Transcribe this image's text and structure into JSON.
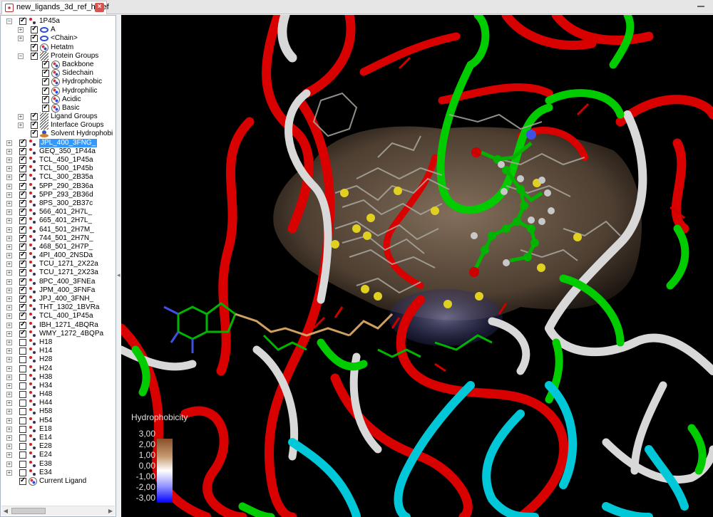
{
  "tab": {
    "title": "new_ligands_3d_ref_h_ref",
    "close": "×"
  },
  "tree": [
    {
      "label": "1P45a",
      "indent": 0,
      "expander": "minus",
      "checked": true,
      "icon": "molecule-icon"
    },
    {
      "label": "A",
      "indent": 1,
      "expander": "plus",
      "checked": true,
      "icon": "chain-icon"
    },
    {
      "label": "<Chain>",
      "indent": 1,
      "expander": "plus",
      "checked": true,
      "icon": "chain-icon"
    },
    {
      "label": "Hetatm",
      "indent": 1,
      "expander": "none",
      "checked": true,
      "icon": "atoms-icon"
    },
    {
      "label": "Protein Groups",
      "indent": 1,
      "expander": "minus",
      "checked": true,
      "icon": "groups-icon"
    },
    {
      "label": "Backbone",
      "indent": 2,
      "expander": "none",
      "checked": true,
      "icon": "atoms-icon"
    },
    {
      "label": "Sidechain",
      "indent": 2,
      "expander": "none",
      "checked": true,
      "icon": "atoms-icon"
    },
    {
      "label": "Hydrophobic",
      "indent": 2,
      "expander": "none",
      "checked": true,
      "icon": "atoms-icon"
    },
    {
      "label": "Hydrophilic",
      "indent": 2,
      "expander": "none",
      "checked": true,
      "icon": "atoms-icon"
    },
    {
      "label": "Acidic",
      "indent": 2,
      "expander": "none",
      "checked": true,
      "icon": "atoms-icon"
    },
    {
      "label": "Basic",
      "indent": 2,
      "expander": "none",
      "checked": true,
      "icon": "atoms-icon"
    },
    {
      "label": "Ligand Groups",
      "indent": 1,
      "expander": "plus",
      "checked": true,
      "icon": "groups-icon"
    },
    {
      "label": "Interface Groups",
      "indent": 1,
      "expander": "plus",
      "checked": true,
      "icon": "groups-icon"
    },
    {
      "label": "Solvent Hydrophobi",
      "indent": 1,
      "expander": "none",
      "checked": true,
      "icon": "solvent-icon"
    },
    {
      "label": "JPL_400_3FNG_",
      "indent": 0,
      "expander": "plus",
      "checked": true,
      "icon": "molecule-icon",
      "selected": true
    },
    {
      "label": "GEQ_350_1P44a",
      "indent": 0,
      "expander": "plus",
      "checked": true,
      "icon": "molecule-icon"
    },
    {
      "label": "TCL_450_1P45a",
      "indent": 0,
      "expander": "plus",
      "checked": true,
      "icon": "molecule-icon"
    },
    {
      "label": "TCL_500_1P45b",
      "indent": 0,
      "expander": "plus",
      "checked": true,
      "icon": "molecule-icon"
    },
    {
      "label": "TCL_300_2B35a",
      "indent": 0,
      "expander": "plus",
      "checked": true,
      "icon": "molecule-icon"
    },
    {
      "label": "5PP_290_2B36a",
      "indent": 0,
      "expander": "plus",
      "checked": true,
      "icon": "molecule-icon"
    },
    {
      "label": "5PP_293_2B36d",
      "indent": 0,
      "expander": "plus",
      "checked": true,
      "icon": "molecule-icon"
    },
    {
      "label": "8PS_300_2B37c",
      "indent": 0,
      "expander": "plus",
      "checked": true,
      "icon": "molecule-icon"
    },
    {
      "label": "566_401_2H7L_",
      "indent": 0,
      "expander": "plus",
      "checked": true,
      "icon": "molecule-icon"
    },
    {
      "label": "665_401_2H7L_",
      "indent": 0,
      "expander": "plus",
      "checked": true,
      "icon": "molecule-icon"
    },
    {
      "label": "641_501_2H7M_",
      "indent": 0,
      "expander": "plus",
      "checked": true,
      "icon": "molecule-icon"
    },
    {
      "label": "744_501_2H7N_",
      "indent": 0,
      "expander": "plus",
      "checked": true,
      "icon": "molecule-icon"
    },
    {
      "label": "468_501_2H7P_",
      "indent": 0,
      "expander": "plus",
      "checked": true,
      "icon": "molecule-icon"
    },
    {
      "label": "4PI_400_2NSDa",
      "indent": 0,
      "expander": "plus",
      "checked": true,
      "icon": "molecule-icon"
    },
    {
      "label": "TCU_1271_2X22a",
      "indent": 0,
      "expander": "plus",
      "checked": true,
      "icon": "molecule-icon"
    },
    {
      "label": "TCU_1271_2X23a",
      "indent": 0,
      "expander": "plus",
      "checked": true,
      "icon": "molecule-icon"
    },
    {
      "label": "8PC_400_3FNEa",
      "indent": 0,
      "expander": "plus",
      "checked": true,
      "icon": "molecule-icon"
    },
    {
      "label": "JPM_400_3FNFa",
      "indent": 0,
      "expander": "plus",
      "checked": true,
      "icon": "molecule-icon"
    },
    {
      "label": "JPJ_400_3FNH_",
      "indent": 0,
      "expander": "plus",
      "checked": true,
      "icon": "molecule-icon"
    },
    {
      "label": "THT_1302_1BVRa",
      "indent": 0,
      "expander": "plus",
      "checked": true,
      "icon": "molecule-icon"
    },
    {
      "label": "TCL_400_1P45a",
      "indent": 0,
      "expander": "plus",
      "checked": true,
      "icon": "molecule-icon"
    },
    {
      "label": "IBH_1271_4BQRa",
      "indent": 0,
      "expander": "plus",
      "checked": true,
      "icon": "molecule-icon"
    },
    {
      "label": "WMY_1272_4BQPa",
      "indent": 0,
      "expander": "plus",
      "checked": true,
      "icon": "molecule-icon"
    },
    {
      "label": "H18",
      "indent": 0,
      "expander": "plus",
      "checked": false,
      "icon": "molecule-icon"
    },
    {
      "label": "H14",
      "indent": 0,
      "expander": "plus",
      "checked": false,
      "icon": "molecule-icon"
    },
    {
      "label": "H28",
      "indent": 0,
      "expander": "plus",
      "checked": false,
      "icon": "molecule-icon"
    },
    {
      "label": "H24",
      "indent": 0,
      "expander": "plus",
      "checked": false,
      "icon": "molecule-icon"
    },
    {
      "label": "H38",
      "indent": 0,
      "expander": "plus",
      "checked": false,
      "icon": "molecule-icon"
    },
    {
      "label": "H34",
      "indent": 0,
      "expander": "plus",
      "checked": false,
      "icon": "molecule-icon"
    },
    {
      "label": "H48",
      "indent": 0,
      "expander": "plus",
      "checked": false,
      "icon": "molecule-icon"
    },
    {
      "label": "H44",
      "indent": 0,
      "expander": "plus",
      "checked": false,
      "icon": "molecule-icon"
    },
    {
      "label": "H58",
      "indent": 0,
      "expander": "plus",
      "checked": false,
      "icon": "molecule-icon"
    },
    {
      "label": "H54",
      "indent": 0,
      "expander": "plus",
      "checked": false,
      "icon": "molecule-icon"
    },
    {
      "label": "E18",
      "indent": 0,
      "expander": "plus",
      "checked": false,
      "icon": "molecule-icon"
    },
    {
      "label": "E14",
      "indent": 0,
      "expander": "plus",
      "checked": false,
      "icon": "molecule-icon"
    },
    {
      "label": "E28",
      "indent": 0,
      "expander": "plus",
      "checked": false,
      "icon": "molecule-icon"
    },
    {
      "label": "E24",
      "indent": 0,
      "expander": "plus",
      "checked": false,
      "icon": "molecule-icon"
    },
    {
      "label": "E38",
      "indent": 0,
      "expander": "plus",
      "checked": false,
      "icon": "molecule-icon"
    },
    {
      "label": "E34",
      "indent": 0,
      "expander": "plus",
      "checked": false,
      "icon": "molecule-icon"
    },
    {
      "label": "Current Ligand",
      "indent": 0,
      "expander": "none",
      "checked": true,
      "icon": "atoms-icon"
    }
  ],
  "legend": {
    "title": "Hydrophobicity",
    "ticks": [
      "3,00",
      "2,00",
      "1,00",
      "0,00",
      "-1,00",
      "-2,00",
      "-3,00"
    ]
  },
  "colors": {
    "selection": "#3399ff",
    "viewport_bg": "#000000",
    "ribbon_red": "#d90000",
    "ribbon_green": "#00cc00",
    "ribbon_white": "#d8d8d8",
    "ribbon_cyan": "#00c8d8",
    "surface": "#6b5a48",
    "hydrophobic_max": "#8a4f28",
    "hydrophobic_min": "#0000ff"
  }
}
